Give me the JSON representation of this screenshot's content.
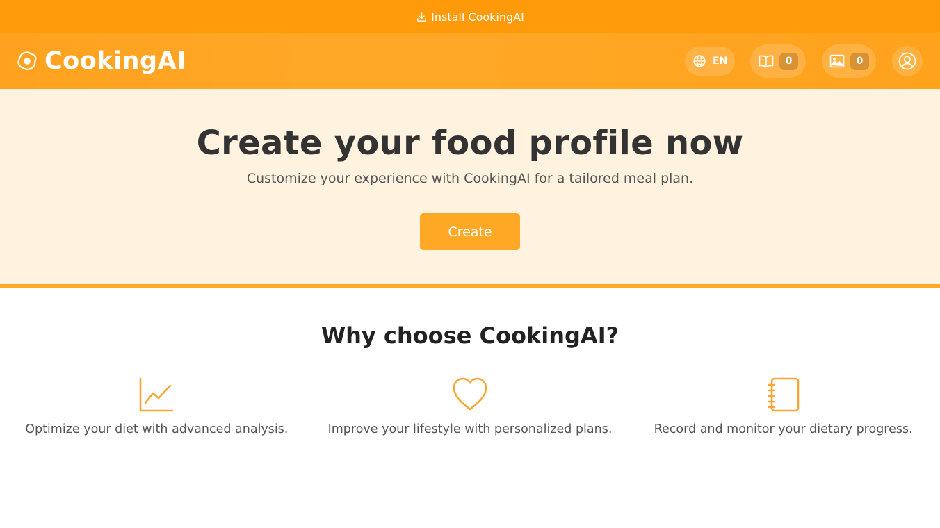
{
  "install_bar": {
    "label": "Install CookingAI"
  },
  "header": {
    "brand": "CookingAI",
    "language": "EN",
    "recipes_count": "0",
    "images_count": "0"
  },
  "hero": {
    "title": "Create your food profile now",
    "subtitle": "Customize your experience with CookingAI for a tailored meal plan.",
    "button": "Create"
  },
  "why": {
    "title": "Why choose CookingAI?",
    "features": [
      {
        "icon": "chart-line-icon",
        "text": "Optimize your diet with advanced analysis."
      },
      {
        "icon": "heart-icon",
        "text": "Improve your lifestyle with personalized plans."
      },
      {
        "icon": "notebook-icon",
        "text": "Record and monitor your dietary progress."
      }
    ]
  },
  "colors": {
    "install_bar": "#ff9a0a",
    "header": "#ffa21f",
    "accent": "#ffa826",
    "hero_bg": "#fff2df"
  }
}
